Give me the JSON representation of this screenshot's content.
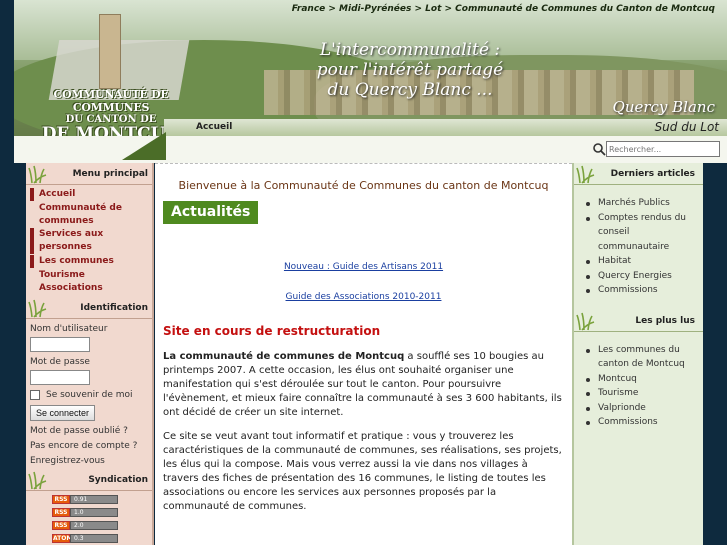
{
  "header": {
    "breadcrumb": "France > Midi-Pyrénées > Lot > Communauté de Communes du Canton de Montcuq",
    "slogan_line1": "L'intercommunalité :",
    "slogan_line2": "pour l'intérêt partagé",
    "slogan_line3": "du Quercy Blanc ...",
    "region_1": "Quercy Blanc",
    "region_2": "Sud du Lot",
    "logo_line1": "COMMUNAUTÉ DE COMMUNES",
    "logo_line2": "DU CANTON DE",
    "logo_line3": "DE MONTCUQ",
    "nav_home": "Accueil"
  },
  "search": {
    "placeholder": "Rechercher..."
  },
  "left": {
    "menu_title": "Menu principal",
    "menu_items": [
      "Accueil",
      "Communauté de communes",
      "Services aux personnes",
      "Les communes",
      "Tourisme",
      "Associations"
    ],
    "ident_title": "Identification",
    "username_label": "Nom d'utilisateur",
    "password_label": "Mot de passe",
    "remember_label": "Se souvenir de moi",
    "login_button": "Se connecter",
    "forgot_password": "Mot de passe oublié ?",
    "no_account": "Pas encore de compte ?",
    "register": "Enregistrez-vous",
    "syndication_title": "Syndication",
    "feeds": [
      {
        "tag": "RSS",
        "ver": "0.91"
      },
      {
        "tag": "RSS",
        "ver": "1.0"
      },
      {
        "tag": "RSS",
        "ver": "2.0"
      },
      {
        "tag": "ATOM",
        "ver": "0.3"
      }
    ]
  },
  "main": {
    "welcome": "Bienvenue à la Communauté de Communes du canton de Montcuq",
    "actualites": "Actualités",
    "link1": "Nouveau : Guide des Artisans 2011",
    "link2": "Guide des Associations 2010-2011",
    "red_heading": "Site en cours de restructuration",
    "para1_bold": "La communauté de communes de Montcuq",
    "para1_rest": " a soufflé ses 10 bougies au printemps 2007. A cette occasion, les élus ont souhaité organiser une manifestation qui s'est déroulée sur tout le canton. Pour poursuivre l'évènement, et mieux faire connaître la communauté à ses 3 600 habitants, ils ont décidé de créer un site internet.",
    "para2": "Ce site se veut avant tout informatif et pratique : vous y trouverez les caractéristiques de la communauté de communes, ses réalisations, ses projets, les élus qui la compose. Mais vous verrez aussi la vie dans nos villages à travers des fiches de présentation des 16 communes,  le listing de toutes les associations ou encore les services aux personnes proposés par la communauté de communes."
  },
  "right": {
    "latest_title": "Derniers articles",
    "latest": [
      "Marchés Publics",
      "Comptes rendus du conseil communautaire",
      "Habitat",
      "Quercy Energies",
      "Commissions"
    ],
    "popular_title": "Les plus lus",
    "popular": [
      "Les communes du canton de Montcuq",
      "Montcuq",
      "Tourisme",
      "Valprionde",
      "Commissions"
    ]
  },
  "colors": {
    "accent_red": "#8b1a1a",
    "actu_green": "#4f8a1f",
    "heading_red": "#c41010",
    "link_blue": "#1a3fa0"
  }
}
